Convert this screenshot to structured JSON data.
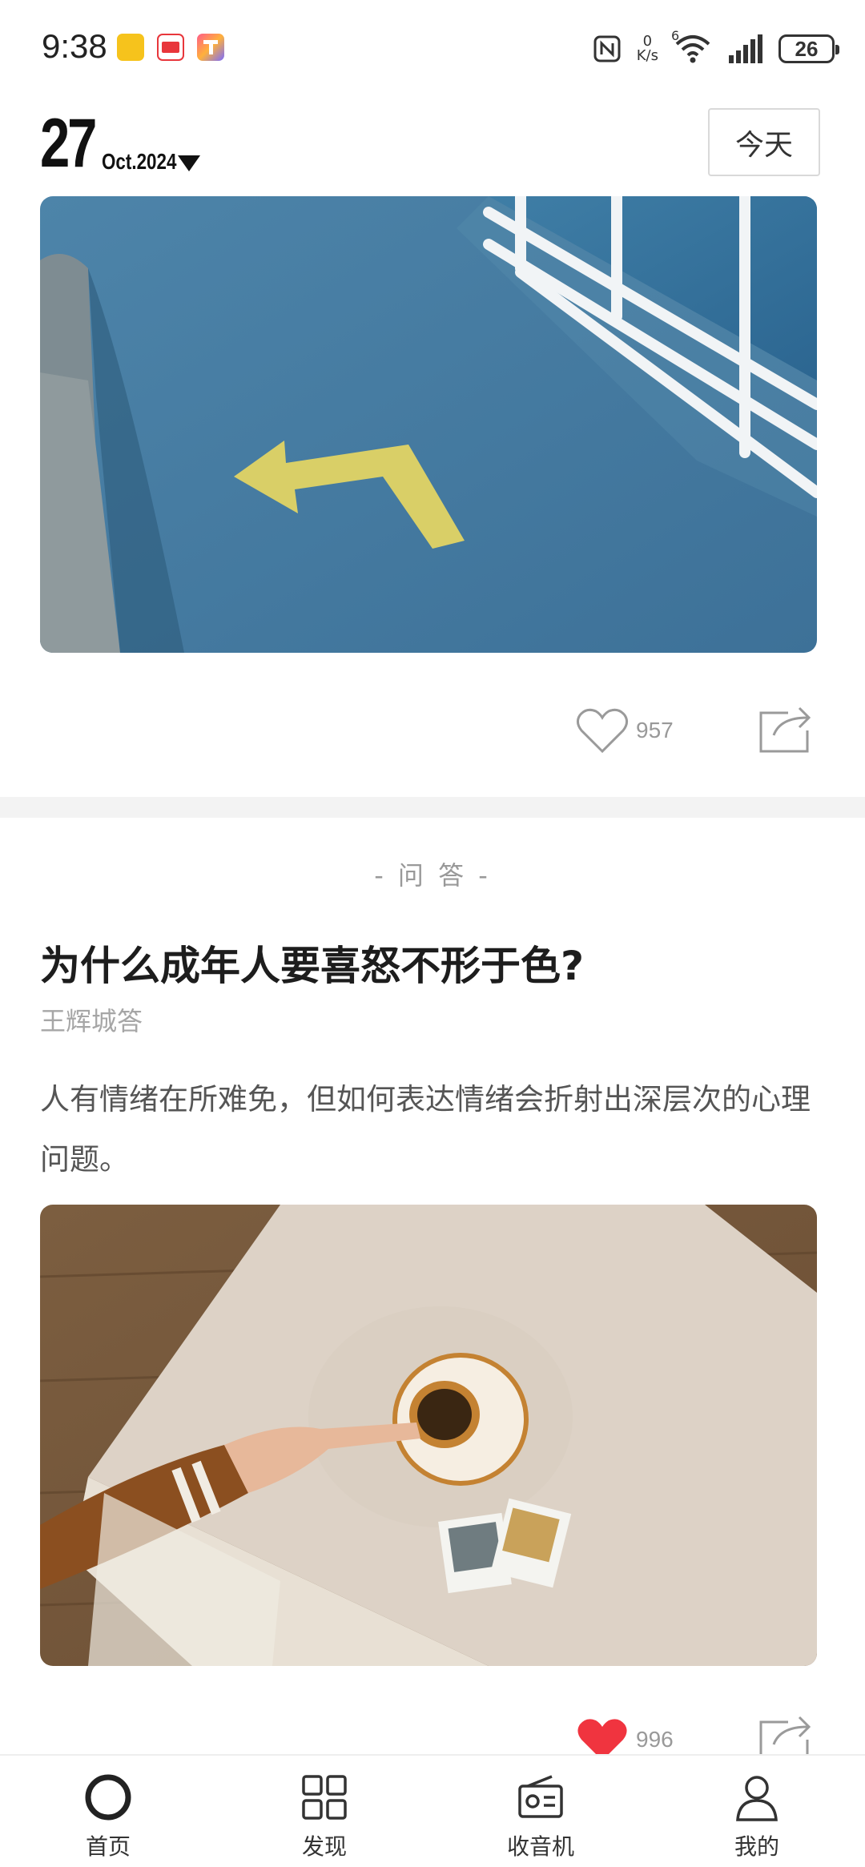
{
  "status_bar": {
    "time": "9:38",
    "net_speed_value": "0",
    "net_speed_unit": "K/s",
    "signal_label": "6",
    "battery": "26",
    "icons": [
      "app-notification-icon-yellow",
      "app-notification-icon-red",
      "app-notification-icon-gradient",
      "nfc-icon",
      "wifi-icon",
      "cell-signal-icon",
      "battery-icon"
    ]
  },
  "header": {
    "day": "27",
    "month_year": "Oct.2024",
    "today_button": "今天"
  },
  "cards": [
    {
      "image": "blue-pier-with-yellow-arrow-photo",
      "likes": "957",
      "liked": false
    },
    {
      "category": "- 问 答 -",
      "title": "为什么成年人要喜怒不形于色?",
      "author": "王辉城答",
      "excerpt": "人有情绪在所难免，但如何表达情绪会折射出深层次的心理问题。",
      "image": "hand-holding-coffee-cup-photo",
      "likes": "996",
      "liked": true
    }
  ],
  "bottom_nav": {
    "items": [
      {
        "label": "首页",
        "icon": "home-circle-icon"
      },
      {
        "label": "发现",
        "icon": "grid-icon"
      },
      {
        "label": "收音机",
        "icon": "radio-icon"
      },
      {
        "label": "我的",
        "icon": "person-icon"
      }
    ]
  },
  "colors": {
    "accent_red": "#f0343f",
    "divider": "#f3f3f3",
    "muted_text": "#999999"
  }
}
